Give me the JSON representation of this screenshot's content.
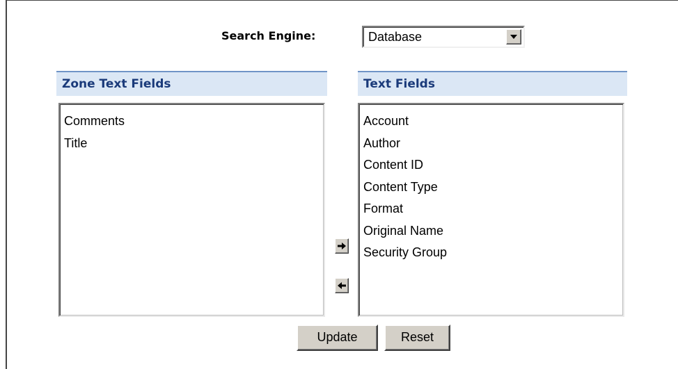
{
  "search_engine": {
    "label": "Search Engine:",
    "selected": "Database"
  },
  "zone_text_fields": {
    "header": "Zone Text Fields",
    "items": [
      "Comments",
      "Title"
    ]
  },
  "text_fields": {
    "header": "Text Fields",
    "items": [
      "Account",
      "Author",
      "Content ID",
      "Content Type",
      "Format",
      "Original Name",
      "Security Group"
    ]
  },
  "buttons": {
    "move_right_icon": "arrow-right-icon",
    "move_left_icon": "arrow-left-icon",
    "update": "Update",
    "reset": "Reset"
  },
  "colors": {
    "header_bg": "#dbe7f5",
    "header_border": "#6f94c7",
    "header_text": "#1a3a7a",
    "button_face": "#d4d0c8"
  }
}
